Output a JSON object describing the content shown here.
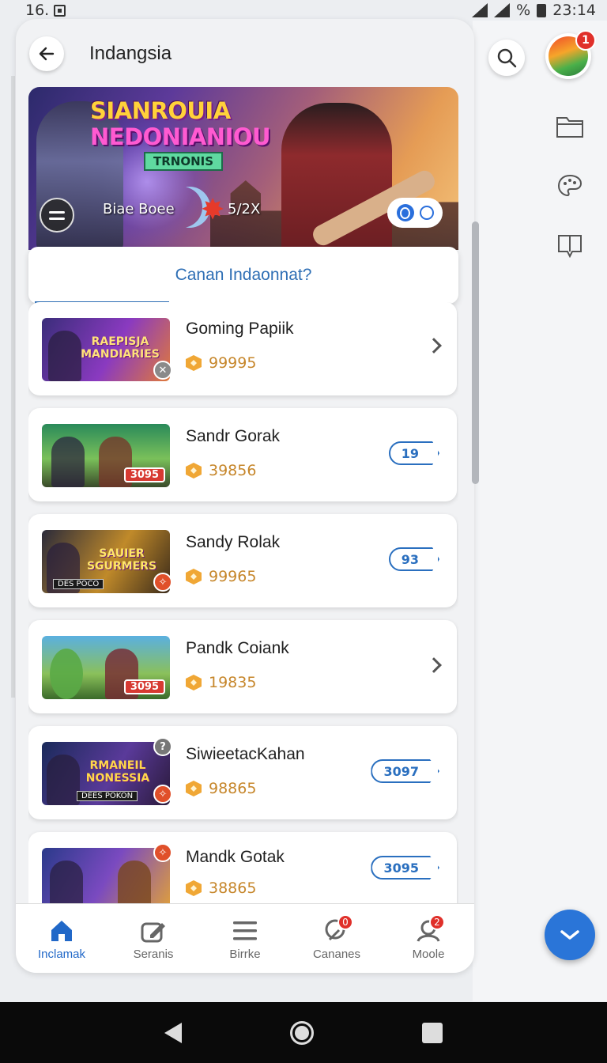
{
  "status_bar": {
    "time_left": "16.",
    "battery_text": "%",
    "time_right": "23:14"
  },
  "header": {
    "title": "Indangsia"
  },
  "avatar": {
    "badge": "1"
  },
  "hero": {
    "title_line1": "SIANROUIA",
    "title_line2": "NEDONIANIOU",
    "badge": "TRNONIS",
    "label_left": "Biae Boee",
    "label_right": "5/2X"
  },
  "prompt": {
    "text": "Canan Indaonnat?"
  },
  "games": [
    {
      "name": "Goming Papiik",
      "coins": "99995",
      "thumb_text": "RAEPISJA MANDIARIES",
      "thumb_tag": "",
      "count": ""
    },
    {
      "name": "Sandr Gorak",
      "coins": "39856",
      "thumb_text": "",
      "thumb_tag": "3095",
      "count": "19"
    },
    {
      "name": "Sandy Rolak",
      "coins": "99965",
      "thumb_text": "SAUIER SGURMERS",
      "thumb_tag": "DES POCO",
      "count": "93"
    },
    {
      "name": "Pandk Coiank",
      "coins": "19835",
      "thumb_text": "",
      "thumb_tag": "3095",
      "count": ""
    },
    {
      "name": "SiwieetacKahan",
      "coins": "98865",
      "thumb_text": "RMANEIL NONESSIA",
      "thumb_tag": "DEES POKON",
      "count": "3097"
    },
    {
      "name": "Mandk Gotak",
      "coins": "38865",
      "thumb_text": "",
      "thumb_tag": "",
      "count": "3095"
    }
  ],
  "bottom_nav": [
    {
      "label": "Inclamak",
      "icon": "home-icon",
      "badge": ""
    },
    {
      "label": "Seranis",
      "icon": "edit-icon",
      "badge": ""
    },
    {
      "label": "Birrke",
      "icon": "menu-icon",
      "badge": ""
    },
    {
      "label": "Cananes",
      "icon": "tag-icon",
      "badge": "0"
    },
    {
      "label": "Moole",
      "icon": "profile-icon",
      "badge": "2"
    }
  ],
  "colors": {
    "accent": "#2a75d8",
    "coin": "#c6862a",
    "badge": "#e0302a"
  }
}
